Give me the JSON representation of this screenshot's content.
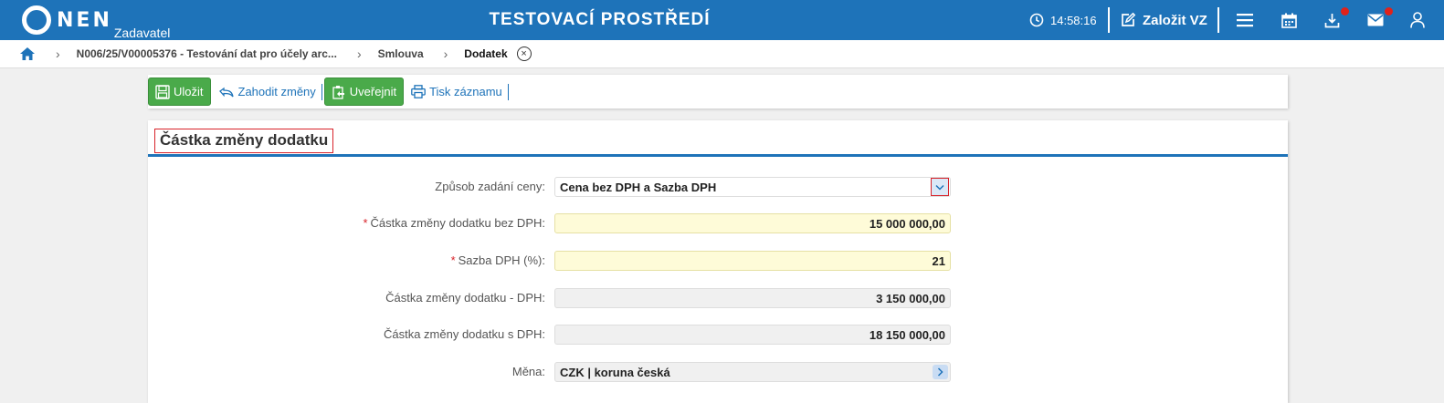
{
  "header": {
    "logo_text": "NEN",
    "logo_sub": "Zadavatel",
    "env_title": "TESTOVACÍ PROSTŘEDÍ",
    "time": "14:58:16",
    "create_label": "Založit VZ",
    "colors": {
      "primary": "#1e73b9",
      "badge": "#e0221b"
    },
    "icons": [
      "clock-icon",
      "edit-icon",
      "menu-icon",
      "calendar-icon",
      "download-icon",
      "mail-icon",
      "user-icon"
    ]
  },
  "breadcrumb": {
    "items": [
      "N006/25/V00005376 - Testování dat pro účely arc...",
      "Smlouva"
    ],
    "active": "Dodatek",
    "close_glyph": "×"
  },
  "toolbar": {
    "save_label": "Uložit",
    "discard_label": "Zahodit změny",
    "publish_label": "Uveřejnit",
    "print_label": "Tisk záznamu",
    "colors": {
      "green": "#4aaa4a"
    }
  },
  "panel": {
    "title": "Částka změny dodatku",
    "fields": {
      "price_mode": {
        "label": "Způsob zadání ceny:",
        "value": "Cena bez DPH a Sazba DPH"
      },
      "amount_net": {
        "label": "Částka změny dodatku bez DPH:",
        "value": "15 000 000,00",
        "required_mark": "*"
      },
      "vat_rate": {
        "label": "Sazba DPH (%):",
        "value": "21",
        "required_mark": "*"
      },
      "vat_amount": {
        "label": "Částka změny dodatku - DPH:",
        "value": "3 150 000,00"
      },
      "amount_gross": {
        "label": "Částka změny dodatku s DPH:",
        "value": "18 150 000,00"
      },
      "currency": {
        "label": "Měna:",
        "value": "CZK | koruna česká"
      }
    }
  }
}
